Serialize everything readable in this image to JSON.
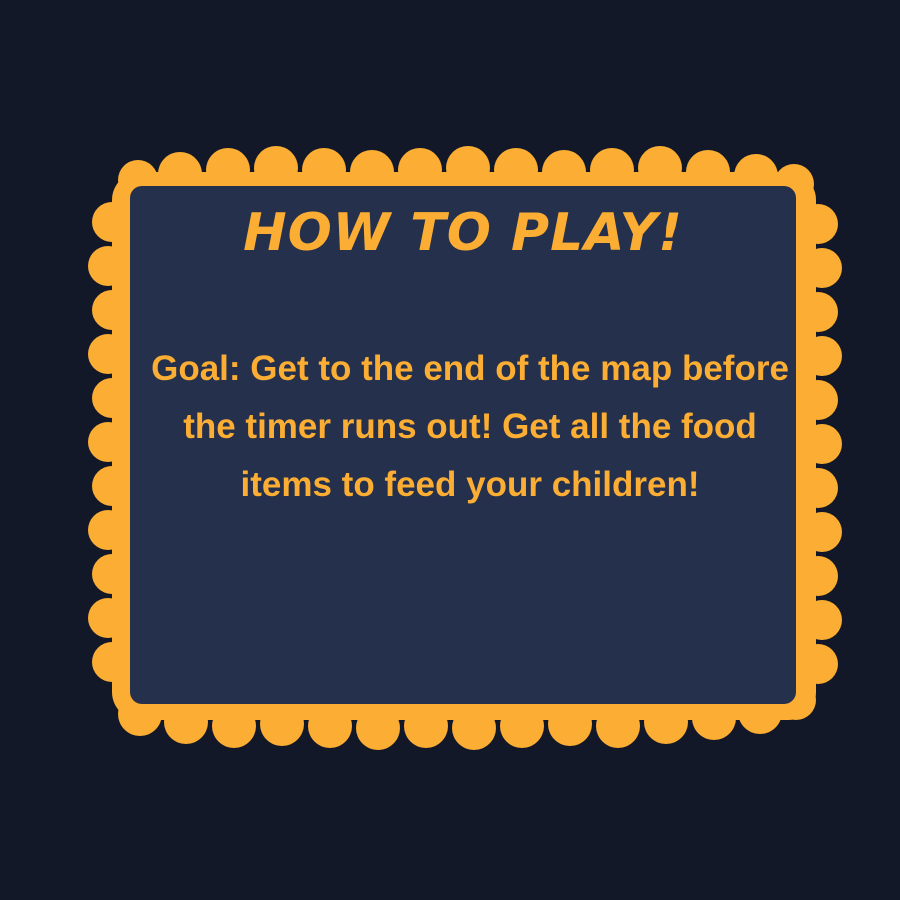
{
  "panel": {
    "title": "HOW TO PLAY!",
    "goal_text": "Goal: Get to the end of the map before the timer runs out! Get all the food items to feed your children!"
  },
  "colors": {
    "background": "#121828",
    "panel_fill": "#25304C",
    "panel_border": "#FBAE33",
    "text": "#FBAE33",
    "title_outline": "#25304C"
  }
}
